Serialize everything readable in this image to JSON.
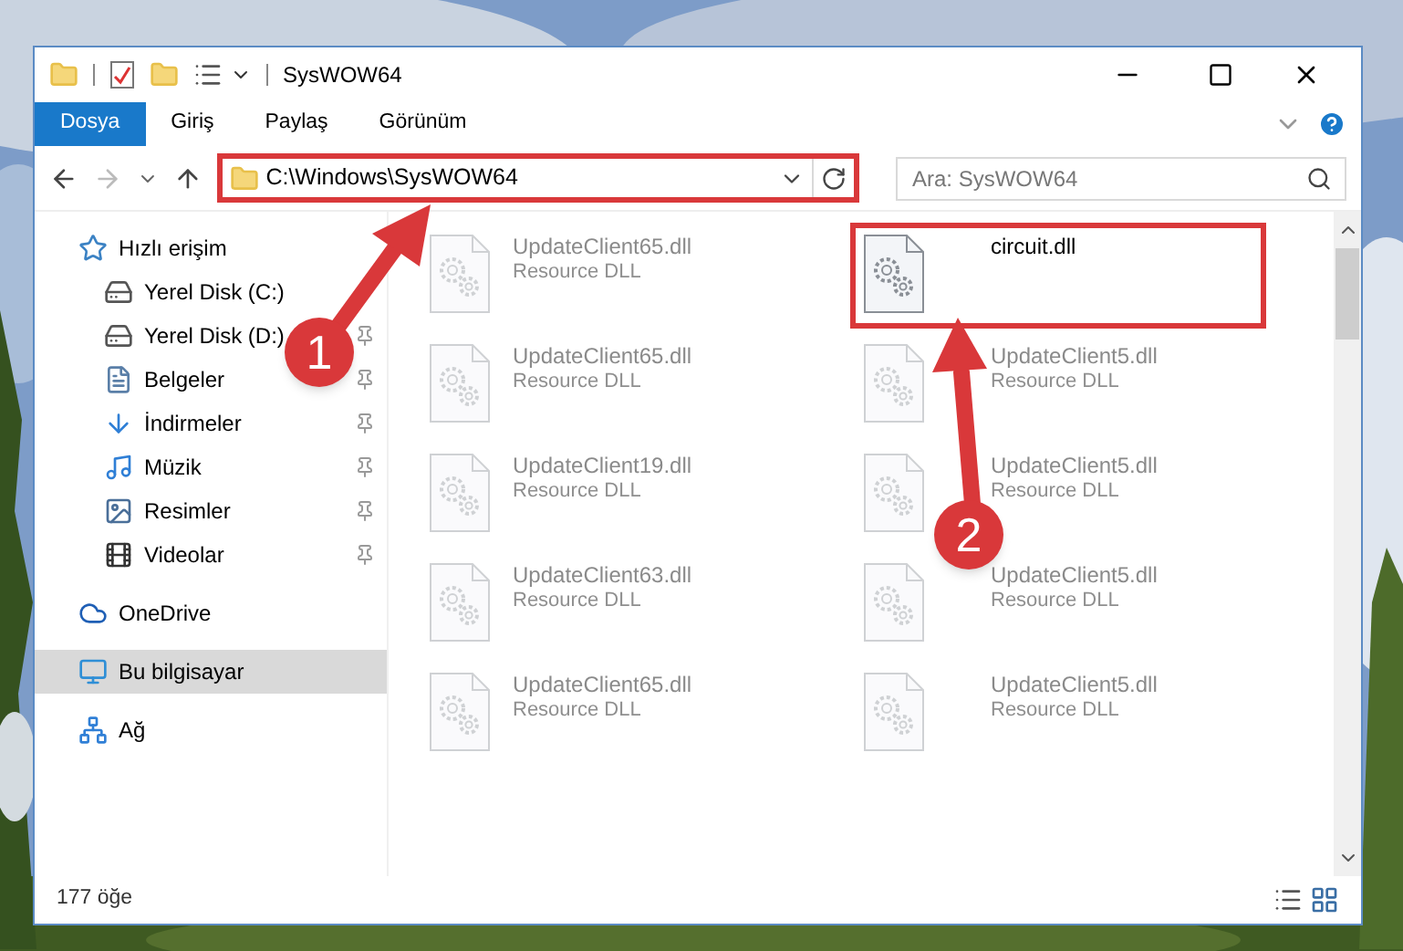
{
  "window": {
    "title": "SysWOW64"
  },
  "ribbon_tabs": [
    {
      "label": "Dosya",
      "selected": true
    },
    {
      "label": "Giriş",
      "selected": false
    },
    {
      "label": "Paylaş",
      "selected": false
    },
    {
      "label": "Görünüm",
      "selected": false
    }
  ],
  "address_bar": {
    "path": "C:\\Windows\\SysWOW64",
    "highlighted": true
  },
  "search": {
    "placeholder": "Ara: SysWOW64"
  },
  "navigation": [
    {
      "label": "Hızlı erişim",
      "kind": "star",
      "selected": false,
      "children": [
        {
          "label": "Yerel Disk (C:)",
          "kind": "system-drive",
          "pinned": false,
          "selected": false
        },
        {
          "label": "Yerel Disk (D:)",
          "kind": "drive",
          "pinned": true,
          "selected": false
        },
        {
          "label": "Belgeler",
          "kind": "documents",
          "pinned": true,
          "selected": false
        },
        {
          "label": "İndirmeler",
          "kind": "download",
          "pinned": true,
          "selected": false
        },
        {
          "label": "Müzik",
          "kind": "music",
          "pinned": true,
          "selected": false
        },
        {
          "label": "Resimler",
          "kind": "pictures",
          "pinned": true,
          "selected": false
        },
        {
          "label": "Videolar",
          "kind": "video",
          "pinned": true,
          "selected": false
        }
      ]
    },
    {
      "label": "OneDrive",
      "kind": "cloud",
      "selected": false
    },
    {
      "label": "Bu bilgisayar",
      "kind": "computer",
      "selected": true
    },
    {
      "label": "Ağ",
      "kind": "network",
      "selected": false
    }
  ],
  "files": [
    {
      "name": "UpdateClient65.dll",
      "type": "Resource DLL",
      "faded": true,
      "highlighted": false
    },
    {
      "name": "circuit.dll",
      "faded": false,
      "highlighted": true
    },
    {
      "name": "UpdateClient65.dll",
      "type": "Resource DLL",
      "faded": true,
      "highlighted": false
    },
    {
      "name": "UpdateClient5.dll",
      "type": "Resource DLL",
      "faded": true,
      "highlighted": false
    },
    {
      "name": "UpdateClient19.dll",
      "type": "Resource DLL",
      "faded": true,
      "highlighted": false
    },
    {
      "name": "UpdateClient5.dll",
      "type": "Resource DLL",
      "faded": true,
      "highlighted": false
    },
    {
      "name": "UpdateClient63.dll",
      "type": "Resource DLL",
      "faded": true,
      "highlighted": false
    },
    {
      "name": "UpdateClient5.dll",
      "type": "Resource DLL",
      "faded": true,
      "highlighted": false
    },
    {
      "name": "UpdateClient65.dll",
      "type": "Resource DLL",
      "faded": true,
      "highlighted": false
    },
    {
      "name": "UpdateClient5.dll",
      "type": "Resource DLL",
      "faded": true,
      "highlighted": false
    }
  ],
  "status_bar": {
    "item_count": "177 öğe"
  },
  "annotations": [
    {
      "number": "1"
    },
    {
      "number": "2"
    }
  ]
}
